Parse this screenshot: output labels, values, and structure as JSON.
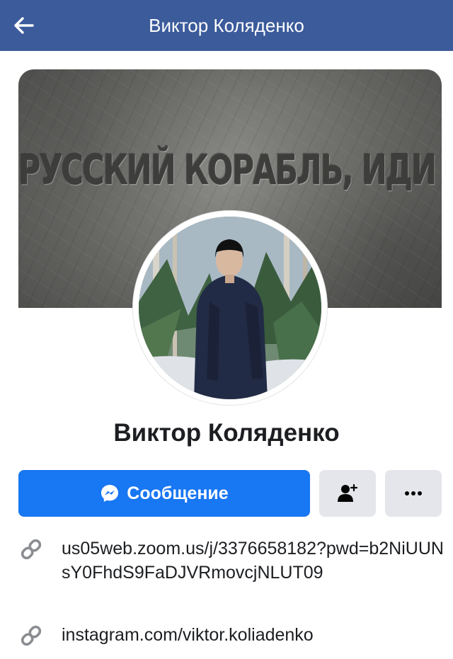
{
  "header": {
    "title": "Виктор Коляденко"
  },
  "cover": {
    "text": "РУССКИЙ КОРАБЛЬ, ИДИ НАХУЙ!"
  },
  "profile": {
    "name": "Виктор Коляденко"
  },
  "actions": {
    "message_label": "Сообщение"
  },
  "links": [
    {
      "text": "us05web.zoom.us/j/3376658182?pwd=b2NiUUNsY0FhdS9FaDJVRmovcjNLUT09"
    },
    {
      "text": "instagram.com/viktor.koliadenko"
    }
  ],
  "colors": {
    "header_bg": "#3b5b9b",
    "primary": "#1877f2",
    "secondary_btn": "#e4e6eb",
    "text": "#1c1e21",
    "icon_gray": "#8a8d91"
  },
  "icons": [
    "back-arrow-icon",
    "messenger-icon",
    "add-friend-icon",
    "more-icon",
    "link-icon"
  ]
}
